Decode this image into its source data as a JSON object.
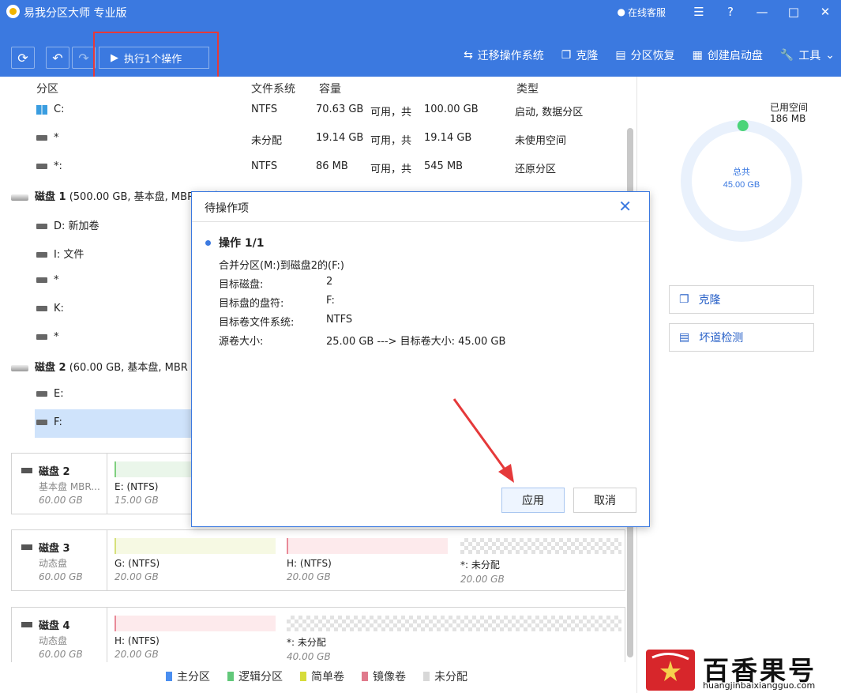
{
  "app": {
    "title": "易我分区大师 专业版",
    "online_service": "在线客服",
    "window_buttons": [
      "☰",
      "?",
      "—",
      "□",
      "✕"
    ]
  },
  "toolbar": {
    "execute_label": "执行1个操作",
    "tools": [
      {
        "icon": "migrate-icon",
        "label": "迁移操作系统"
      },
      {
        "icon": "clone-icon",
        "label": "克隆"
      },
      {
        "icon": "recovery-icon",
        "label": "分区恢复"
      },
      {
        "icon": "windows-icon",
        "label": "创建启动盘"
      },
      {
        "icon": "wrench-icon",
        "label": "工具"
      }
    ]
  },
  "table": {
    "columns": [
      "分区",
      "文件系统",
      "容量",
      "类型"
    ],
    "rows": [
      {
        "name": "C:",
        "fs": "NTFS",
        "free": "70.63 GB",
        "mid": "可用，共",
        "total": "100.00 GB",
        "type": "启动, 数据分区"
      },
      {
        "name": "*",
        "fs": "未分配",
        "free": "19.14 GB",
        "mid": "可用，共",
        "total": "19.14 GB",
        "type": "未使用空间"
      },
      {
        "name": "*:",
        "fs": "NTFS",
        "free": "86 MB",
        "mid": "可用，共",
        "total": "545 MB",
        "type": "还原分区"
      }
    ],
    "disk1": {
      "name": "磁盘 1",
      "desc": "(500.00 GB, 基本盘, MBR, 磁盘"
    },
    "disk1_parts": [
      "D: 新加卷",
      "I: 文件",
      "*",
      "K:",
      "*"
    ],
    "disk2": {
      "name": "磁盘 2",
      "desc": "(60.00 GB, 基本盘, MBR"
    },
    "disk2_parts": [
      "E:",
      "F:"
    ]
  },
  "diskmap": [
    {
      "name": "磁盘 2",
      "type": "基本盘 MBR...",
      "size": "60.00 GB",
      "parts": [
        {
          "label": "E:  (NTFS)",
          "size": "15.00 GB"
        }
      ]
    },
    {
      "name": "磁盘 3",
      "type": "动态盘",
      "size": "60.00 GB",
      "parts": [
        {
          "label": "G:  (NTFS)",
          "size": "20.00 GB"
        },
        {
          "label": "H:  (NTFS)",
          "size": "20.00 GB"
        },
        {
          "label": "*: 未分配",
          "size": "20.00 GB"
        }
      ]
    },
    {
      "name": "磁盘 4",
      "type": "动态盘",
      "size": "60.00 GB",
      "parts": [
        {
          "label": "H:  (NTFS)",
          "size": "20.00 GB"
        },
        {
          "label": "*: 未分配",
          "size": "40.00 GB"
        }
      ]
    }
  ],
  "legend": [
    {
      "label": "主分区",
      "color": "#4a8ef0"
    },
    {
      "label": "逻辑分区",
      "color": "#62c87a"
    },
    {
      "label": "简单卷",
      "color": "#d6dc3a"
    },
    {
      "label": "镜像卷",
      "color": "#e07a8c"
    },
    {
      "label": "未分配",
      "color": "#d8d8d8"
    }
  ],
  "side": {
    "used_label": "已用空间",
    "used_value": "186 MB",
    "total_label": "总共",
    "total_value": "45.00 GB",
    "used_fraction": 0.004,
    "buttons": [
      {
        "icon": "clone-icon",
        "label": "克隆"
      },
      {
        "icon": "surface-test-icon",
        "label": "坏道检测"
      }
    ]
  },
  "dialog": {
    "title": "待操作项",
    "op_title": "操作 1/1",
    "op_desc": "合并分区(M:)到磁盘2的(F:)",
    "fields": [
      {
        "k": "目标磁盘:",
        "v": "2"
      },
      {
        "k": "目标盘的盘符:",
        "v": "F:"
      },
      {
        "k": "目标卷文件系统:",
        "v": "NTFS"
      },
      {
        "k": "源卷大小:",
        "v": "25.00 GB ---> 目标卷大小: 45.00 GB"
      }
    ],
    "apply": "应用",
    "cancel": "取消"
  },
  "watermark": {
    "cn": "百香果号",
    "en": "huangjinbaixiangguo.com"
  },
  "colors": {
    "accent": "#3b79e0",
    "highlight": "#e5393a"
  }
}
